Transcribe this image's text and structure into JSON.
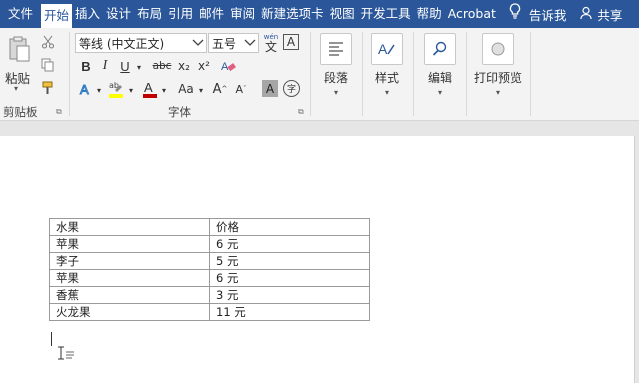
{
  "tabs": [
    "文件",
    "开始",
    "插入",
    "设计",
    "布局",
    "引用",
    "邮件",
    "审阅",
    "新建选项卡",
    "视图",
    "开发工具",
    "帮助",
    "Acrobat"
  ],
  "active_tab": "开始",
  "tell_me": "告诉我",
  "share": "共享",
  "clipboard": {
    "paste_label": "粘贴",
    "group_label": "剪贴板"
  },
  "font": {
    "name": "等线 (中文正文)",
    "size": "五号",
    "group_label": "字体",
    "bold": "B",
    "italic": "I",
    "underline": "U",
    "strike": "abc",
    "subscript": "x₂",
    "superscript": "x²",
    "phonetic": "wén",
    "phonetic_char": "文",
    "charborder": "A",
    "change_case": "Aa",
    "grow": "A",
    "shrink": "A",
    "shade": "A",
    "enclose": "字"
  },
  "paragraph": {
    "label": "段落"
  },
  "styles": {
    "label": "样式"
  },
  "editing": {
    "label": "编辑"
  },
  "print_preview": {
    "label": "打印预览"
  },
  "colors": {
    "accent": "#2b579a",
    "highlight": "#ffff00",
    "font_color": "#c00000"
  },
  "table": {
    "headers": [
      "水果",
      "价格"
    ],
    "rows": [
      [
        "苹果",
        "6 元"
      ],
      [
        "李子",
        "5 元"
      ],
      [
        "苹果",
        "6 元"
      ],
      [
        "香蕉",
        "3 元"
      ],
      [
        "火龙果",
        "11 元"
      ]
    ]
  }
}
